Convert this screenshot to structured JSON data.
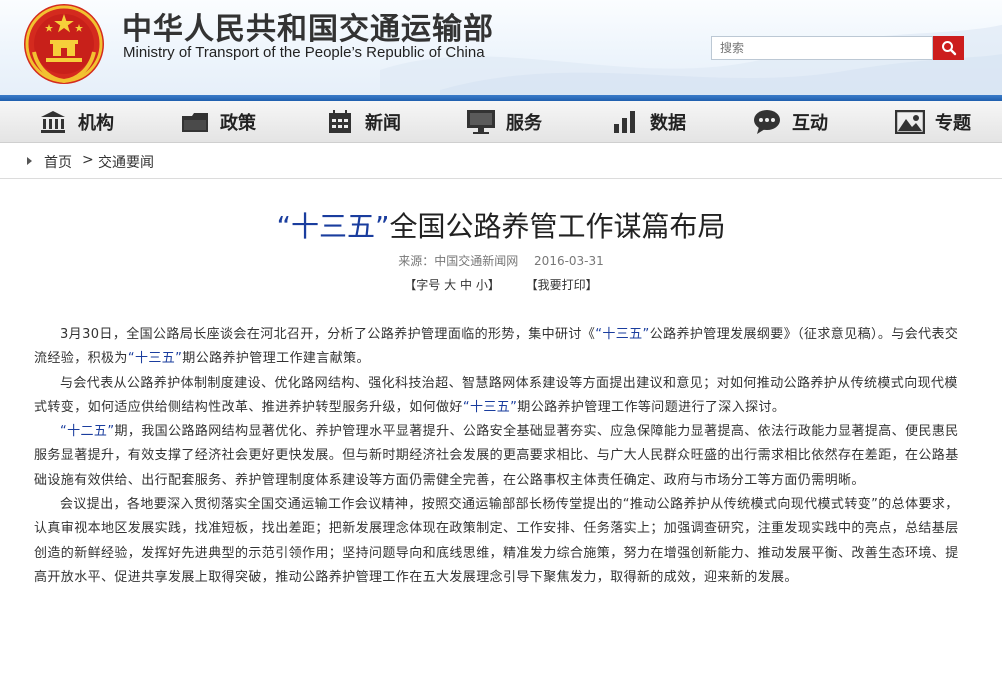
{
  "header": {
    "title_cn": "中华人民共和国交通运输部",
    "title_en": "Ministry of Transport of the People’s Republic of China",
    "search_placeholder": "搜索"
  },
  "nav": [
    {
      "label": "机构",
      "icon": "institution-icon"
    },
    {
      "label": "政策",
      "icon": "briefcase-icon"
    },
    {
      "label": "新闻",
      "icon": "calendar-icon"
    },
    {
      "label": "服务",
      "icon": "monitor-icon"
    },
    {
      "label": "数据",
      "icon": "bar-chart-icon"
    },
    {
      "label": "互动",
      "icon": "chat-bubble-icon"
    },
    {
      "label": "专题",
      "icon": "image-icon"
    }
  ],
  "breadcrumb": {
    "home": "首页",
    "separator": ">",
    "current": "交通要闻"
  },
  "article": {
    "title_highlight": "“十三五”",
    "title_rest": "全国公路养管工作谋篇布局",
    "source": "来源：中国交通新闻网",
    "date": "2016-03-31",
    "font_size_label": "【字号",
    "font_large": "大",
    "font_medium": "中",
    "font_small": "小】",
    "print_label": "【我要打印】",
    "p1_a": "3月30日，全国公路局长座谈会在河北召开，分析了公路养护管理面临的形势，集中研讨《",
    "p1_hl1": "“十三五”",
    "p1_b": "公路养护管理发展纲要》（征求意见稿）。与会代表交流经验，积极为",
    "p1_hl2": "“十三五”",
    "p1_c": "期公路养护管理工作建言献策。",
    "p2_a": "与会代表从公路养护体制制度建设、优化路网结构、强化科技治超、智慧路网体系建设等方面提出建议和意见；对如何推动公路养护从传统模式向现代模式转变，如何适应供给侧结构性改革、推进养护转型服务升级，如何做好",
    "p2_hl": "“十三五”",
    "p2_b": "期公路养护管理工作等问题进行了深入探讨。",
    "p3_hl": "“十二五”",
    "p3_a": "期，我国公路路网结构显著优化、养护管理水平显著提升、公路安全基础显著夯实、应急保障能力显著提高、依法行政能力显著提高、便民惠民服务显著提升，有效支撑了经济社会更好更快发展。但与新时期经济社会发展的更高要求相比、与广大人民群众旺盛的出行需求相比依然存在差距，在公路基础设施有效供给、出行配套服务、养护管理制度体系建设等方面仍需健全完善，在公路事权主体责任确定、政府与市场分工等方面仍需明晰。",
    "p4": "会议提出，各地要深入贯彻落实全国交通运输工作会议精神，按照交通运输部部长杨传堂提出的“推动公路养护从传统模式向现代模式转变”的总体要求，认真审视本地区发展实践，找准短板，找出差距；把新发展理念体现在政策制定、工作安排、任务落实上；加强调查研究，注重发现实践中的亮点，总结基层创造的新鲜经验，发挥好先进典型的示范引领作用；坚持问题导向和底线思维，精准发力综合施策，努力在增强创新能力、推动发展平衡、改善生态环境、提高开放水平、促进共享发展上取得突破，推动公路养护管理工作在五大发展理念引导下聚焦发力，取得新的成效，迎来新的发展。"
  },
  "colors": {
    "accent_blue": "#1a3d9e",
    "search_red": "#cc1d1d",
    "bar_blue": "#2a6bbb"
  }
}
